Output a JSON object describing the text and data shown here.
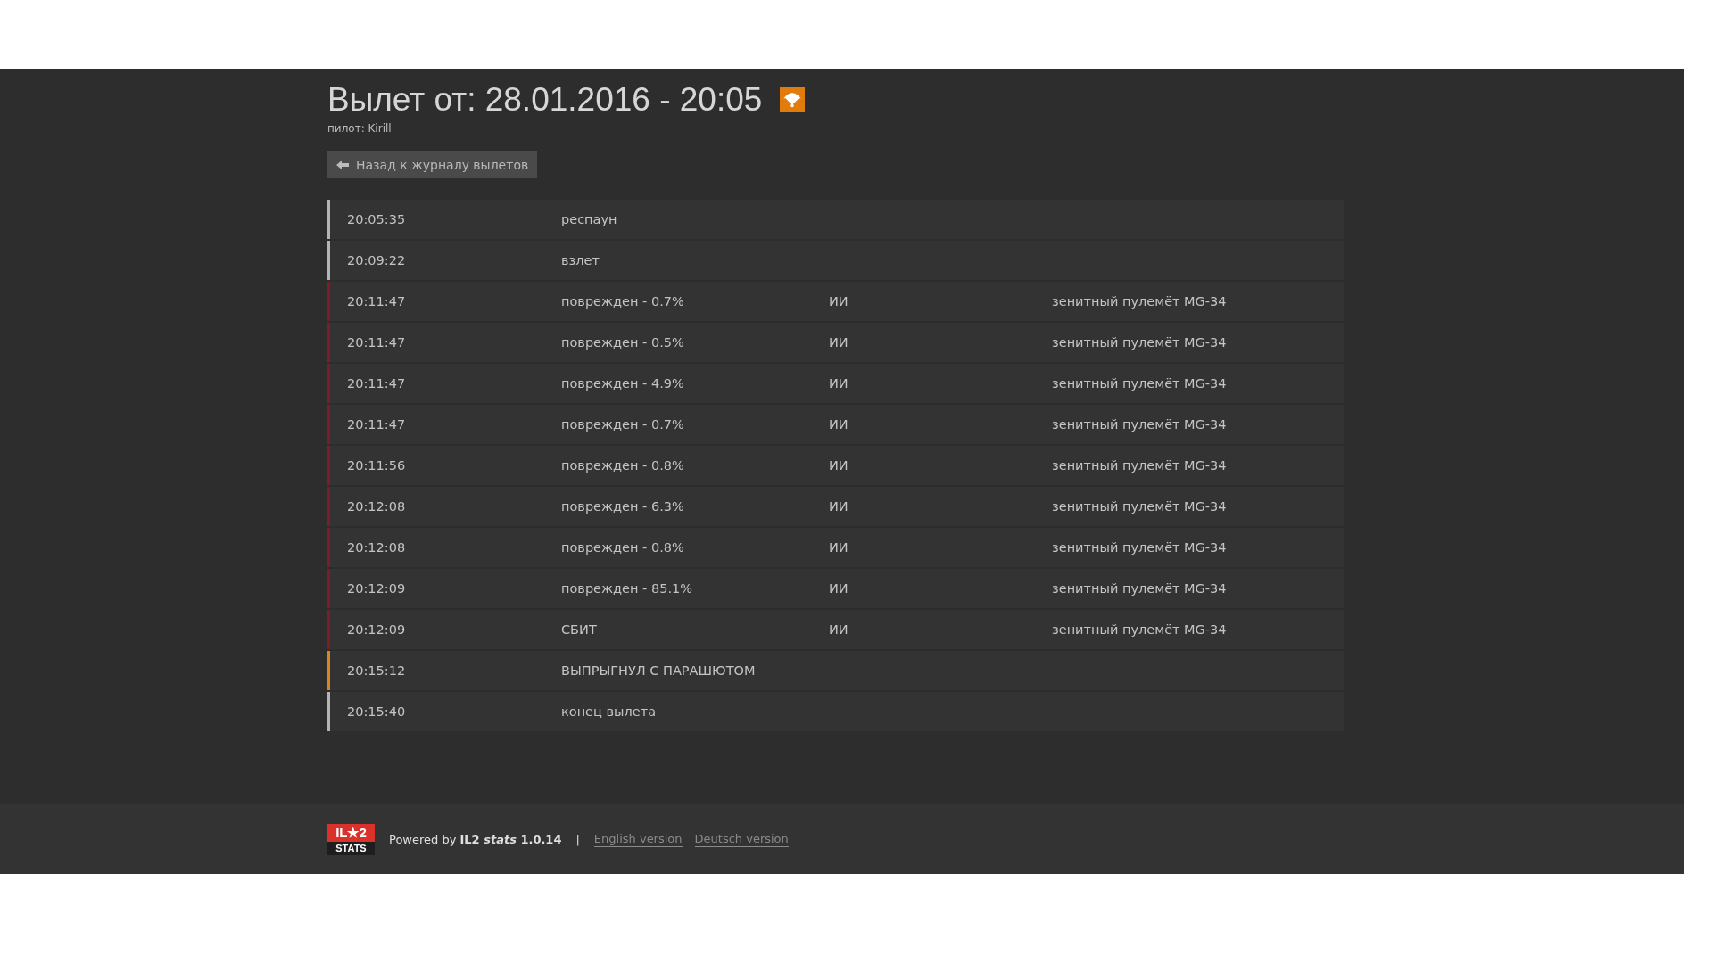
{
  "header": {
    "title": "Вылет от: 28.01.2016 - 20:05",
    "pilot": "пилот: Kirill"
  },
  "back_button": {
    "label": "Назад к журналу вылетов"
  },
  "events": [
    {
      "time": "20:05:35",
      "event": "респаун",
      "color": "#b4b4b4"
    },
    {
      "time": "20:09:22",
      "event": "взлет",
      "color": "#b4b4b4"
    },
    {
      "time": "20:11:47",
      "event": "поврежден - 0.7%",
      "by": "ИИ",
      "weapon": "зенитный пулемёт MG-34",
      "color": "#7d1b27"
    },
    {
      "time": "20:11:47",
      "event": "поврежден - 0.5%",
      "by": "ИИ",
      "weapon": "зенитный пулемёт MG-34",
      "color": "#7d1b27"
    },
    {
      "time": "20:11:47",
      "event": "поврежден - 4.9%",
      "by": "ИИ",
      "weapon": "зенитный пулемёт MG-34",
      "color": "#7d1b27"
    },
    {
      "time": "20:11:47",
      "event": "поврежден - 0.7%",
      "by": "ИИ",
      "weapon": "зенитный пулемёт MG-34",
      "color": "#7d1b27"
    },
    {
      "time": "20:11:56",
      "event": "поврежден - 0.8%",
      "by": "ИИ",
      "weapon": "зенитный пулемёт MG-34",
      "color": "#7d1b27"
    },
    {
      "time": "20:12:08",
      "event": "поврежден - 6.3%",
      "by": "ИИ",
      "weapon": "зенитный пулемёт MG-34",
      "color": "#7d1b27"
    },
    {
      "time": "20:12:08",
      "event": "поврежден - 0.8%",
      "by": "ИИ",
      "weapon": "зенитный пулемёт MG-34",
      "color": "#7d1b27"
    },
    {
      "time": "20:12:09",
      "event": "поврежден - 85.1%",
      "by": "ИИ",
      "weapon": "зенитный пулемёт MG-34",
      "color": "#7d1b27"
    },
    {
      "time": "20:12:09",
      "event": "СБИТ",
      "by": "ИИ",
      "weapon": "зенитный пулемёт MG-34",
      "color": "#7d1b27"
    },
    {
      "time": "20:15:12",
      "event": "ВЫПРЫГНУЛ С ПАРАШЮТОМ",
      "color": "#d9861c"
    },
    {
      "time": "20:15:40",
      "event": "конец вылета",
      "color": "#b4b4b4"
    }
  ],
  "footer": {
    "logo_top": "IL★2",
    "logo_bottom": "STATS",
    "powered": "Powered by **IL2 *stats* 1.0.14**",
    "separator": "|",
    "links": [
      "English version",
      "Deutsch version"
    ]
  }
}
